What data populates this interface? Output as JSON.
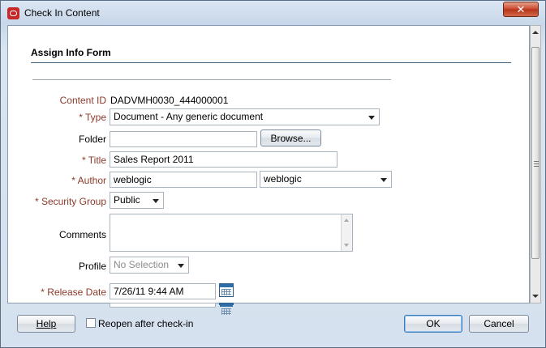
{
  "window": {
    "title": "Check In Content",
    "close_glyph": "✕"
  },
  "form": {
    "header": "Assign Info Form",
    "content_id_label": "Content ID",
    "content_id_value": "DADVMH0030_444000001",
    "type_label": "* Type",
    "type_value": "Document - Any generic document",
    "folder_label": "Folder",
    "folder_value": "",
    "browse_label": "Browse...",
    "title_label": "* Title",
    "title_value": "Sales Report 2011",
    "author_label": "* Author",
    "author_value": "weblogic",
    "author_select_value": "weblogic",
    "security_group_label": "* Security Group",
    "security_group_value": "Public",
    "comments_label": "Comments",
    "comments_value": "",
    "profile_label": "Profile",
    "profile_value": "No Selection",
    "release_date_label": "* Release Date",
    "release_date_value": "7/26/11 9:44 AM"
  },
  "footer": {
    "help_label": "Help",
    "reopen_label": "Reopen after check-in",
    "reopen_checked": false,
    "ok_label": "OK",
    "cancel_label": "Cancel"
  },
  "icons": {
    "app": "oracle-logo-icon",
    "calendar": "calendar-icon"
  }
}
